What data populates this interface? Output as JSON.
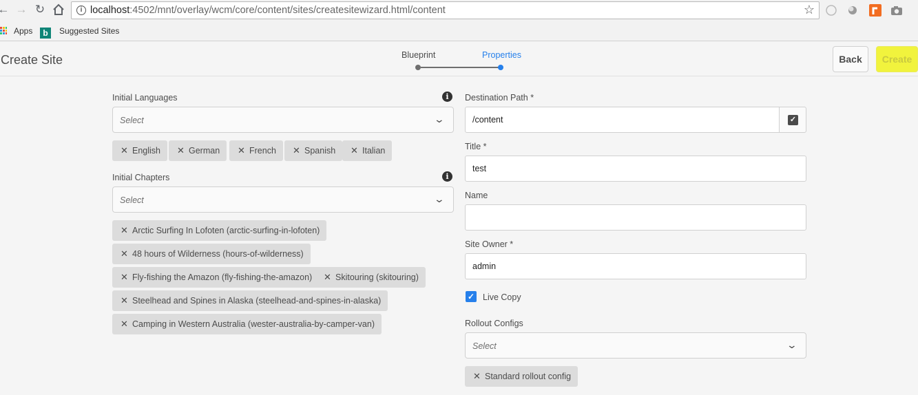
{
  "browser": {
    "url_host": "localhost",
    "url_rest": ":4502/mnt/overlay/wcm/core/content/sites/createsitewizard.html/content",
    "bookmarks": [
      {
        "label": "Apps",
        "icon": "apps-grid-icon"
      },
      {
        "label": "Suggested Sites",
        "icon": "bing-icon"
      }
    ]
  },
  "header": {
    "title": "Create Site",
    "steps": [
      {
        "label": "Blueprint",
        "state": "done"
      },
      {
        "label": "Properties",
        "state": "active"
      }
    ],
    "back_label": "Back",
    "create_label": "Create"
  },
  "left": {
    "languages": {
      "label": "Initial Languages",
      "placeholder": "Select",
      "tags": [
        "English",
        "German",
        "French",
        "Spanish",
        "Italian"
      ]
    },
    "chapters": {
      "label": "Initial Chapters",
      "placeholder": "Select",
      "tags": [
        "Arctic Surfing In Lofoten (arctic-surfing-in-lofoten)",
        "48 hours of Wilderness (hours-of-wilderness)",
        "Fly-fishing the Amazon (fly-fishing-the-amazon)",
        "Skitouring (skitouring)",
        "Steelhead and Spines in Alaska (steelhead-and-spines-in-alaska)",
        "Camping in Western Australia (wester-australia-by-camper-van)"
      ]
    }
  },
  "right": {
    "destination": {
      "label": "Destination Path *",
      "value": "/content"
    },
    "title": {
      "label": "Title *",
      "value": "test"
    },
    "name": {
      "label": "Name",
      "value": ""
    },
    "owner": {
      "label": "Site Owner *",
      "value": "admin"
    },
    "live_copy": {
      "label": "Live Copy",
      "checked": true
    },
    "rollout": {
      "label": "Rollout Configs",
      "placeholder": "Select",
      "tags": [
        "Standard rollout config"
      ]
    }
  },
  "colors": {
    "accent": "#2680eb",
    "highlight": "#f1f33d",
    "tag_bg": "#dcdcdc"
  }
}
